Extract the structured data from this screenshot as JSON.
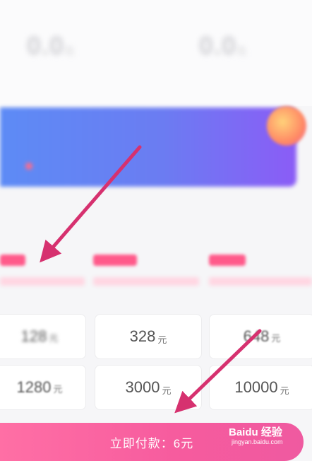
{
  "stats": [
    {
      "label": "",
      "value": "0.0",
      "unit": "元"
    },
    {
      "label": "",
      "value": "0.0",
      "unit": "元"
    }
  ],
  "banner": {
    "line1": "",
    "line2": ""
  },
  "sections": {
    "left_title": "",
    "right_title": ""
  },
  "packages": [
    {
      "amount": "",
      "note": ""
    },
    {
      "amount": "",
      "note": ""
    },
    {
      "amount": "",
      "note": ""
    }
  ],
  "grid": [
    {
      "value": "128",
      "unit": "元"
    },
    {
      "value": "328",
      "unit": "元"
    },
    {
      "value": "648",
      "unit": "元"
    },
    {
      "value": "1280",
      "unit": "元"
    },
    {
      "value": "3000",
      "unit": "元"
    },
    {
      "value": "10000",
      "unit": "元"
    }
  ],
  "pay": {
    "label": "立即付款：6元"
  },
  "watermark": {
    "brand": "Baidu 经验",
    "url": "jingyan.baidu.com"
  },
  "colors": {
    "accent": "#f65b9e",
    "arrow": "#d6316f",
    "banner_start": "#5d8bf5",
    "banner_end": "#8b5cf6"
  }
}
